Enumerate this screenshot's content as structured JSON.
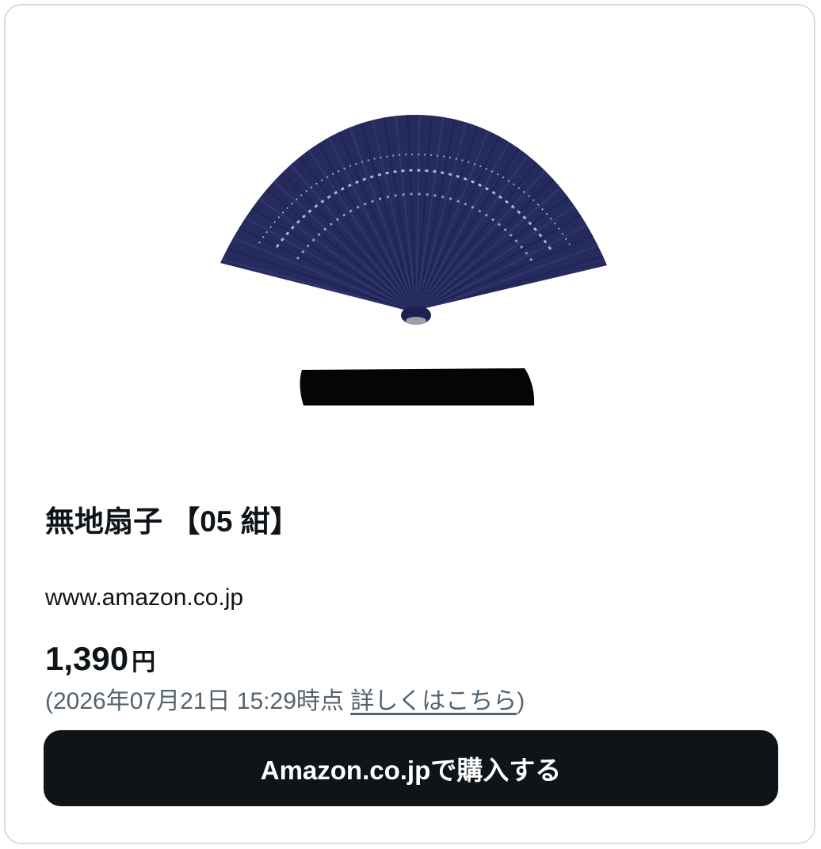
{
  "card": {
    "title": "無地扇子 【05 紺】",
    "domain": "www.amazon.co.jp",
    "price": {
      "amount": "1,390",
      "currency": "円"
    },
    "timestamp": {
      "open_paren": "(",
      "text": "2026年07月21日 15:29時点 ",
      "link_label": "詳しくはこちら",
      "close_paren": ")"
    },
    "buy_button_label": "Amazon.co.jpで購入する",
    "image": {
      "subject": "folding-fan-icon",
      "fan_color": "#262b5e",
      "case_color": "#050505"
    }
  }
}
